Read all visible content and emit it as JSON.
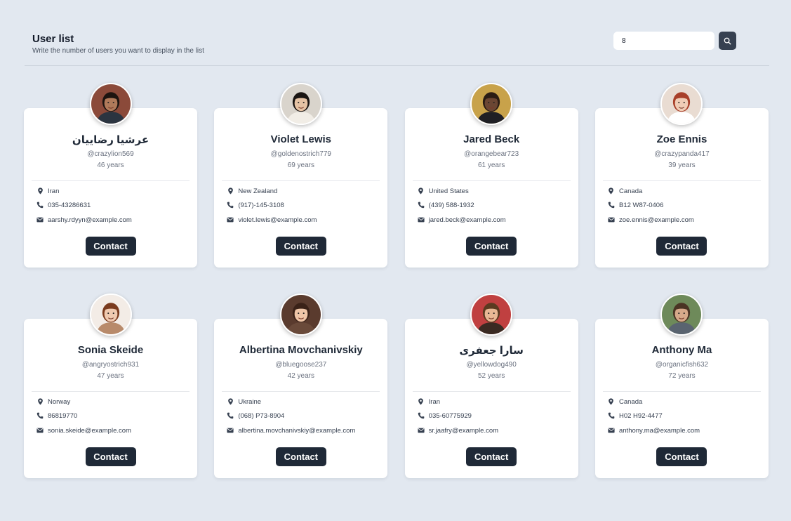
{
  "header": {
    "title": "User list",
    "subtitle": "Write the number of users you want to display in the list",
    "search_value": "8",
    "search_icon": "search-icon"
  },
  "contact_label": "Contact",
  "icons": {
    "location": "map-pin-icon",
    "phone": "phone-icon",
    "email": "mail-icon"
  },
  "users": [
    {
      "name": "عرشيا رضاييان",
      "username": "@crazylion569",
      "age": "46 years",
      "country": "Iran",
      "phone": "035-43286631",
      "email": "aarshy.rdyyn@example.com"
    },
    {
      "name": "Violet Lewis",
      "username": "@goldenostrich779",
      "age": "69 years",
      "country": "New Zealand",
      "phone": "(917)-145-3108",
      "email": "violet.lewis@example.com"
    },
    {
      "name": "Jared Beck",
      "username": "@orangebear723",
      "age": "61 years",
      "country": "United States",
      "phone": "(439) 588-1932",
      "email": "jared.beck@example.com"
    },
    {
      "name": "Zoe Ennis",
      "username": "@crazypanda417",
      "age": "39 years",
      "country": "Canada",
      "phone": "B12 W87-0406",
      "email": "zoe.ennis@example.com"
    },
    {
      "name": "Sonia Skeide",
      "username": "@angryostrich931",
      "age": "47 years",
      "country": "Norway",
      "phone": "86819770",
      "email": "sonia.skeide@example.com"
    },
    {
      "name": "Albertina Movchanivskiy",
      "username": "@bluegoose237",
      "age": "42 years",
      "country": "Ukraine",
      "phone": "(068) P73-8904",
      "email": "albertina.movchanivskiy@example.com"
    },
    {
      "name": "سارا جعفری",
      "username": "@yellowdog490",
      "age": "52 years",
      "country": "Iran",
      "phone": "035-60775929",
      "email": "sr.jaafry@example.com"
    },
    {
      "name": "Anthony Ma",
      "username": "@organicfish632",
      "age": "72 years",
      "country": "Canada",
      "phone": "H02 H92-4477",
      "email": "anthony.ma@example.com"
    }
  ],
  "colors": {
    "background": "#e2e8f0",
    "card": "#ffffff",
    "button": "#1f2937",
    "search_button": "#374151"
  }
}
